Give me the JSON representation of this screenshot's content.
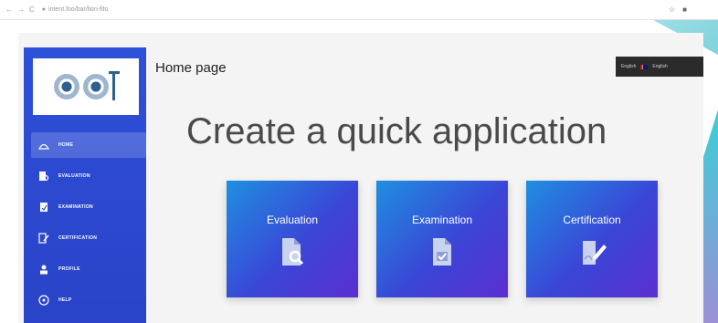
{
  "browser": {
    "nav_glyphs": [
      "←",
      "→",
      "C"
    ],
    "url": "intent.foo/bar/lion-fifo",
    "right_icons": [
      "star-icon",
      "extensions-icon"
    ]
  },
  "app": {
    "page_title": "Home page",
    "headline": "Create a quick application",
    "language": {
      "label_1": "English",
      "label_2": "English"
    },
    "sidebar": {
      "items": [
        {
          "label": "HOME",
          "icon": "home-icon",
          "active": true
        },
        {
          "label": "EVALUATION",
          "icon": "evaluation-icon",
          "active": false
        },
        {
          "label": "EXAMINATION",
          "icon": "examination-icon",
          "active": false
        },
        {
          "label": "CERTIFICATION",
          "icon": "certification-icon",
          "active": false
        },
        {
          "label": "PROFILE",
          "icon": "profile-icon",
          "active": false
        },
        {
          "label": "HELP",
          "icon": "help-icon",
          "active": false
        }
      ]
    },
    "cards": [
      {
        "label": "Evaluation",
        "icon": "document-search-icon"
      },
      {
        "label": "Examination",
        "icon": "document-check-icon"
      },
      {
        "label": "Certification",
        "icon": "document-sign-icon"
      }
    ]
  },
  "colors": {
    "sidebar": "#2d50d8",
    "card_start": "#1f8fe0",
    "card_end": "#5b2fd0",
    "lang_box": "#2b2b2b"
  }
}
